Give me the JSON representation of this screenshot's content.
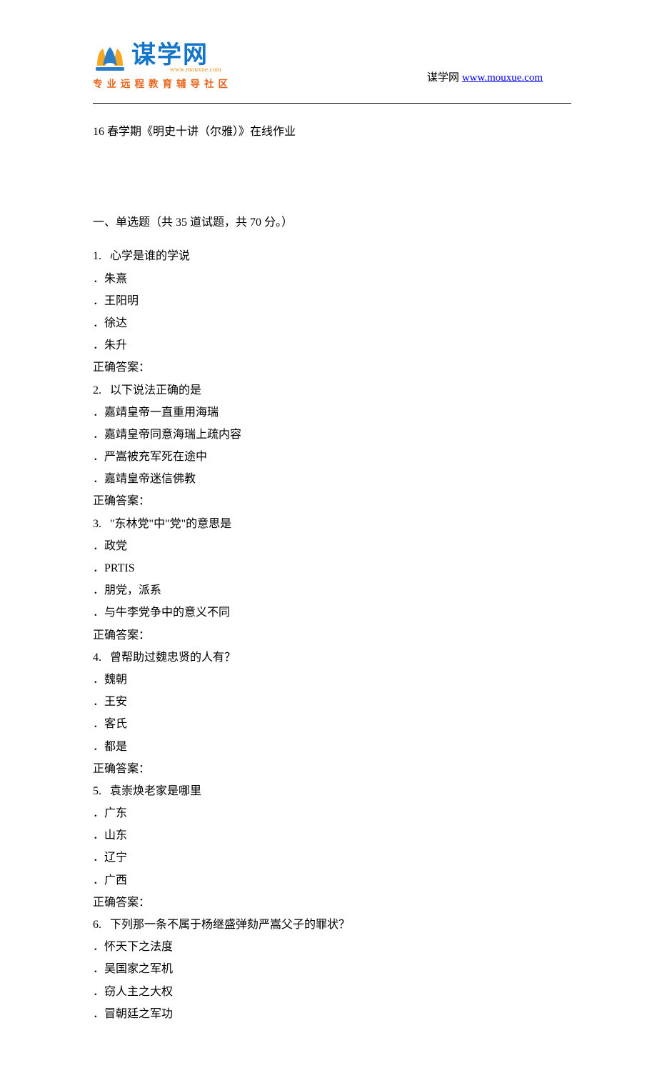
{
  "header": {
    "logo_text": "谋学网",
    "logo_url": "www.mouxue.com",
    "tagline": "专业远程教育辅导社区",
    "right_prefix": "谋学网 ",
    "right_link_text": "www.mouxue.com"
  },
  "document": {
    "title": "16 春学期《明史十讲（尔雅）》在线作业",
    "section_heading": "一、单选题（共 35 道试题，共 70 分。）",
    "answer_label": "正确答案：",
    "questions": [
      {
        "num": "1.",
        "stem": "心学是谁的学说",
        "options": [
          "．朱熹",
          "．王阳明",
          "．徐达",
          "．朱升"
        ]
      },
      {
        "num": "2.",
        "stem": "以下说法正确的是",
        "options": [
          "．嘉靖皇帝一直重用海瑞",
          "．嘉靖皇帝同意海瑞上疏内容",
          "．严嵩被充军死在途中",
          "．嘉靖皇帝迷信佛教"
        ]
      },
      {
        "num": "3.",
        "stem": "\"东林党\"中\"党\"的意思是",
        "options": [
          "．政党",
          "．PRTIS",
          "．朋党，派系",
          "．与牛李党争中的意义不同"
        ]
      },
      {
        "num": "4.",
        "stem": "曾帮助过魏忠贤的人有？",
        "options": [
          "．魏朝",
          "．王安",
          "．客氏",
          "．都是"
        ]
      },
      {
        "num": "5.",
        "stem": "袁崇焕老家是哪里",
        "options": [
          "．广东",
          "．山东",
          "．辽宁",
          "．广西"
        ]
      },
      {
        "num": "6.",
        "stem": "下列那一条不属于杨继盛弹劾严嵩父子的罪状？",
        "options": [
          "．怀天下之法度",
          "．吴国家之军机",
          "．窃人主之大权",
          "．冒朝廷之军功"
        ]
      }
    ]
  }
}
